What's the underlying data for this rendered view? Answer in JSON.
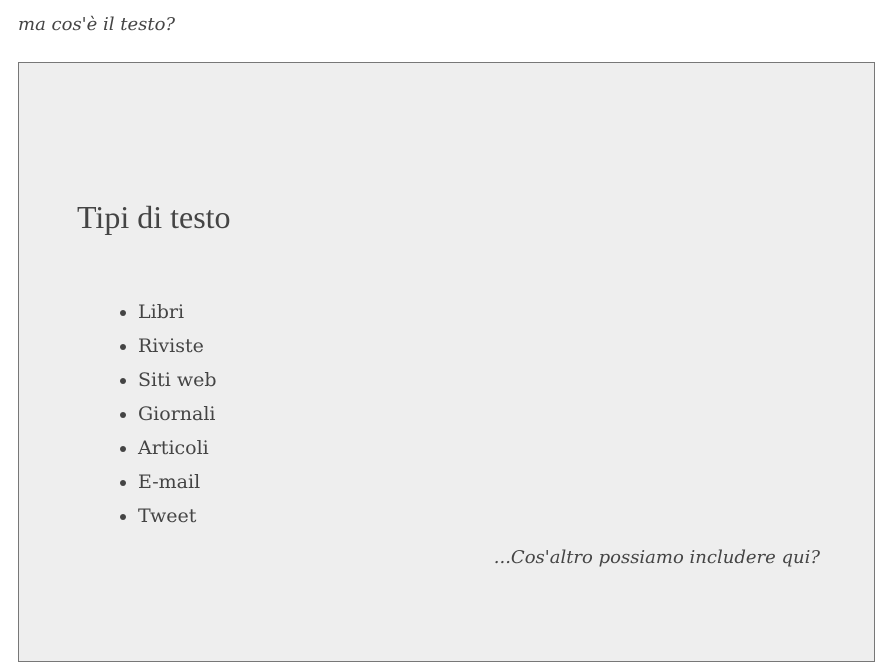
{
  "intro": "ma cos'è il testo?",
  "box": {
    "title": "Tipi di testo",
    "items": [
      "Libri",
      "Riviste",
      "Siti web",
      "Giornali",
      "Articoli",
      "E-mail",
      "Tweet"
    ],
    "outro": "...Cos'altro possiamo includere qui?"
  }
}
